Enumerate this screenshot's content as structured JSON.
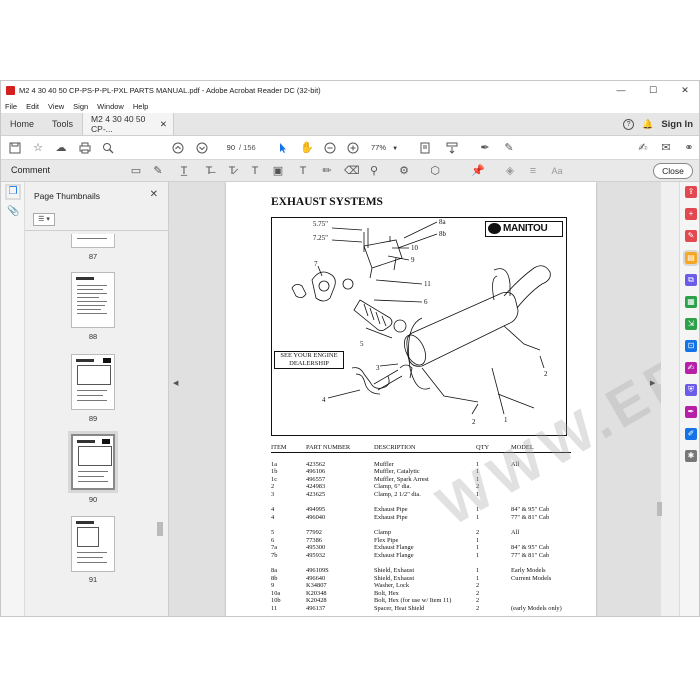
{
  "window": {
    "title": "M2 4 30 40 50 CP-PS-P-PL-PXL PARTS MANUAL.pdf - Adobe Acrobat Reader DC (32-bit)",
    "minimize": "—",
    "maximize": "☐",
    "close": "✕"
  },
  "menu": [
    "File",
    "Edit",
    "View",
    "Sign",
    "Window",
    "Help"
  ],
  "tabs": {
    "home": "Home",
    "tools": "Tools",
    "document": "M2 4 30 40 50 CP-...",
    "document_close": "✕",
    "help": "?",
    "bell": "🔔",
    "sign_in": "Sign In"
  },
  "toolbar": {
    "current_page": "90",
    "total_pages": "/ 156",
    "zoom": "77%"
  },
  "comment_bar": {
    "label": "Comment",
    "close": "Close",
    "font_tool": "Aa"
  },
  "thumbnail_panel": {
    "title": "Page Thumbnails",
    "close": "✕",
    "options": "☰ ▾",
    "pages": [
      "87",
      "88",
      "89",
      "90",
      "91"
    ]
  },
  "page": {
    "title": "EXHAUST SYSTEMS",
    "logo": "MANITOU",
    "engine_note": "SEE YOUR ENGINE DEALERSHIP",
    "callouts": {
      "c575": "5.75\"",
      "c725": "7.25\"",
      "c8a": "8a",
      "c8b": "8b",
      "c10": "10",
      "c9": "9",
      "c11": "11",
      "c6": "6",
      "c7": "7",
      "c5": "5",
      "c3": "3",
      "c4": "4",
      "c2a": "2",
      "c2b": "2",
      "c1": "1"
    },
    "watermark": "WWW.EPCDEPO.COM",
    "table": {
      "headers": [
        "ITEM",
        "PART NUMBER",
        "DESCRIPTION",
        "QTY",
        "MODEL"
      ],
      "rows": [
        [
          "1a",
          "423562",
          "Muffler",
          "1",
          "All"
        ],
        [
          "1b",
          "496106",
          "Muffler, Catalytic",
          "1",
          ""
        ],
        [
          "1c",
          "496557",
          "Muffler, Spark Arrest",
          "1",
          ""
        ],
        [
          "2",
          "424983",
          "Clamp, 6\" dia.",
          "2",
          ""
        ],
        [
          "3",
          "423625",
          "Clamp, 2 1/2\" dia.",
          "1",
          ""
        ],
        [
          "",
          "",
          "",
          "",
          ""
        ],
        [
          "4",
          "494995",
          "Exhaust Pipe",
          "1",
          "84\" & 95\" Cab"
        ],
        [
          "4",
          "496040",
          "Exhaust Pipe",
          "1",
          "77\" & 81\" Cab"
        ],
        [
          "",
          "",
          "",
          "",
          ""
        ],
        [
          "5",
          "77992",
          "Clamp",
          "2",
          "All"
        ],
        [
          "6",
          "77386",
          "Flex Pipe",
          "1",
          ""
        ],
        [
          "7a",
          "495300",
          "Exhaust Flange",
          "1",
          "84\" & 95\" Cab"
        ],
        [
          "7b",
          "495932",
          "Exhaust Flange",
          "1",
          "77\" & 81\" Cab"
        ],
        [
          "",
          "",
          "",
          "",
          ""
        ],
        [
          "8a",
          "496109S",
          "Shield, Exhaust",
          "1",
          "Early Models"
        ],
        [
          "8b",
          "496640",
          "Shield, Exhaust",
          "1",
          "Current Models"
        ],
        [
          "9",
          "K34807",
          "Washer, Lock",
          "2",
          ""
        ],
        [
          "10a",
          "K20348",
          "Bolt, Hex",
          "2",
          ""
        ],
        [
          "10b",
          "K20428",
          "Bolt, Hex (for use w/ Item 11)",
          "2",
          ""
        ],
        [
          "11",
          "496137",
          "Spacer, Heat Shield",
          "2",
          "(early Models only)"
        ]
      ]
    }
  },
  "colors": {
    "accent_blue": "#1473e6",
    "acrobat_red": "#d4201f"
  }
}
